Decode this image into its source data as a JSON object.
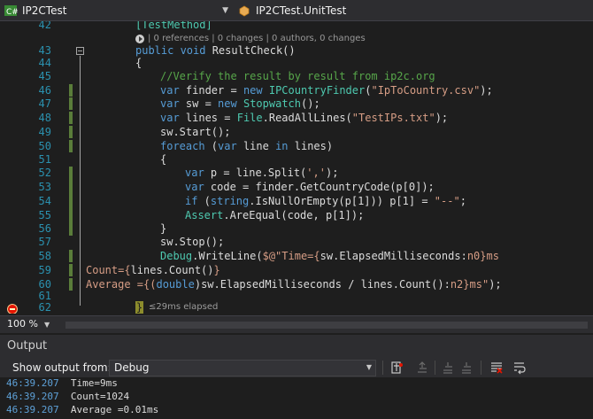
{
  "nav": {
    "project": "IP2CTest",
    "type_scope": "IP2CTest.UnitTest"
  },
  "editor": {
    "attribute_line": "[TestMethod]",
    "codelens": "| 0 references | 0 changes | 0 authors, 0 changes",
    "line_numbers": [
      "42",
      "43",
      "44",
      "45",
      "46",
      "47",
      "48",
      "49",
      "50",
      "51",
      "52",
      "53",
      "54",
      "55",
      "56",
      "57",
      "58",
      "59",
      "60",
      "61",
      "62"
    ],
    "lines": {
      "l43": {
        "kw": "public void",
        "rest": " ResultCheck()"
      },
      "l44": "{",
      "l45": "//Verify the result by result from ip2c.org",
      "l46": {
        "a": "var",
        "b": " finder = ",
        "c": "new",
        "d": " ",
        "e": "IPCountryFinder",
        "f": "(",
        "g": "\"IpToCountry.csv\"",
        "h": ");"
      },
      "l47": {
        "a": "var",
        "b": " sw = ",
        "c": "new",
        "d": " ",
        "e": "Stopwatch",
        "f": "();"
      },
      "l48": {
        "a": "var",
        "b": " lines = ",
        "c": "File",
        "d": ".ReadAllLines(",
        "e": "\"TestIPs.txt\"",
        "f": ");"
      },
      "l49": "sw.Start();",
      "l50": {
        "a": "foreach",
        "b": " (",
        "c": "var",
        "d": " line ",
        "e": "in",
        "f": " lines)"
      },
      "l51": "{",
      "l52": {
        "a": "var",
        "b": " p = line.Split(",
        "c": "','",
        "d": ");"
      },
      "l53": {
        "a": "var",
        "b": " code = finder.GetCountryCode(p[0]);"
      },
      "l54": {
        "a": "if",
        "b": " (",
        "c": "string",
        "d": ".IsNullOrEmpty(p[1])) p[1] = ",
        "e": "\"--\"",
        "f": ";"
      },
      "l55": {
        "a": "Assert",
        "b": ".AreEqual(code, p[1]);"
      },
      "l56": "}",
      "l57": "sw.Stop();",
      "l58": {
        "a": "Debug",
        "b": ".WriteLine(",
        "c": "$@\"Time={",
        "d": "sw.ElapsedMilliseconds:",
        "e": "n0}ms"
      },
      "l59": {
        "a": "Count={",
        "b": "lines.Count()",
        "c": "}"
      },
      "l60": {
        "a": "Average ={(",
        "b": "double",
        "c": ")sw.ElapsedMilliseconds / lines.Count():",
        "d": "n2}ms\"",
        "e": ");"
      },
      "l62": "}"
    },
    "perf_tip": "≤29ms elapsed"
  },
  "zoom": {
    "level": "100 %"
  },
  "output": {
    "title": "Output",
    "show_from_label": "Show output from:",
    "source": "Debug",
    "entries": [
      {
        "time": "46:39.207",
        "message": "Time=9ms"
      },
      {
        "time": "46:39.207",
        "message": "Count=1024"
      },
      {
        "time": "46:39.207",
        "message": "Average =0.01ms"
      }
    ]
  },
  "colors": {
    "keyword": "#569cd6",
    "type": "#4ec9b0",
    "string": "#d69d85",
    "comment": "#57a64a",
    "line_number": "#2b91af",
    "change_bar": "#5a7d3a"
  }
}
